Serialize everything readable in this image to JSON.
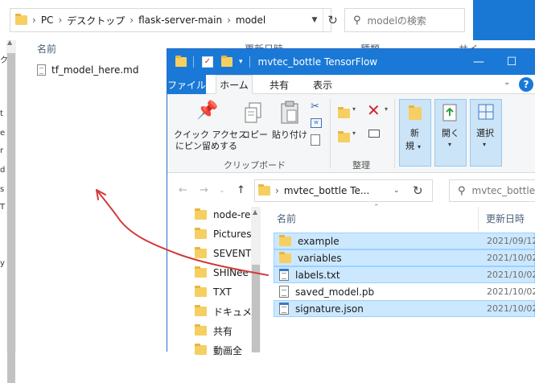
{
  "back_window": {
    "breadcrumb": [
      "PC",
      "デスクトップ",
      "flask-server-main",
      "model"
    ],
    "search_placeholder": "modelの検索",
    "columns": {
      "name": "名前",
      "date": "更新日時",
      "type": "種類",
      "size": "サイ"
    },
    "files": [
      {
        "name": "tf_model_here.md"
      }
    ],
    "nav_edge_fragments": [
      "ク",
      "t",
      "e",
      "r",
      "d",
      "s",
      "T",
      "y"
    ]
  },
  "front_window": {
    "title": "mvtec_bottle TensorFlow",
    "ribbon_tabs": {
      "file": "ファイル",
      "home": "ホーム",
      "share": "共有",
      "view": "表示"
    },
    "ribbon": {
      "pin_label_line1": "クイック アクセス",
      "pin_label_line2": "にピン留めする",
      "copy_label": "コピー",
      "paste_label": "貼り付け",
      "clipboard_group": "クリップボード",
      "organize_group": "整理",
      "new_label_line1": "新",
      "new_label_line2": "規",
      "open_label": "開く",
      "select_label": "選択"
    },
    "address": "mvtec_bottle Te...",
    "search_placeholder": "mvtec_bottle",
    "nav_items": [
      "node-re",
      "Pictures",
      "SEVENTE",
      "SHINee",
      "TXT",
      "ドキュメン",
      "共有",
      "動画全"
    ],
    "columns": {
      "name": "名前",
      "date": "更新日時"
    },
    "files": [
      {
        "name": "example",
        "date": "2021/09/12",
        "icon": "folder-icon",
        "selected": true
      },
      {
        "name": "variables",
        "date": "2021/10/02",
        "icon": "folder-icon",
        "selected": true
      },
      {
        "name": "labels.txt",
        "date": "2021/10/02",
        "icon": "notepad-icon",
        "selected": true
      },
      {
        "name": "saved_model.pb",
        "date": "2021/10/02",
        "icon": "file-icon",
        "selected": false
      },
      {
        "name": "signature.json",
        "date": "2021/10/02",
        "icon": "notepad-icon",
        "selected": true
      }
    ]
  },
  "annotation": {
    "color": "#d33a3a",
    "description_icon": "arrow-annotation"
  },
  "colors": {
    "titlebar": "#1a79d6",
    "selection": "#cce8ff",
    "folder": "#f6cf63"
  }
}
